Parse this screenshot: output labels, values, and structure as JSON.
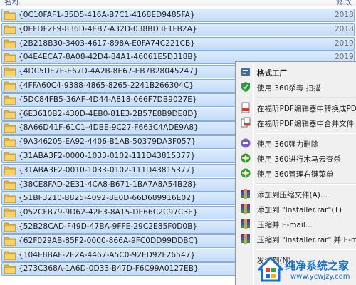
{
  "header": {
    "name_col": "名称",
    "date_col": "修改日"
  },
  "files": [
    {
      "name": "{0C10FAF1-35D5-416A-B7C1-4168ED9485FA}",
      "date": "2018."
    },
    {
      "name": "{0EFDF2F9-836D-4EB7-A32D-038BD3F1FB2A}",
      "date": "2018."
    },
    {
      "name": "{2B218B30-3403-4617-898A-E0FA74C221CB}",
      "date": "2019."
    },
    {
      "name": "{04E4ECA7-8A08-42D4-84A1-46061E5D318B}",
      "date": "2019."
    },
    {
      "name": "{4DC5DE7E-E67D-4A2B-8E67-EB7B28045247}",
      "date": ""
    },
    {
      "name": "{4FFA60C4-9388-4865-8265-2241B266304C}",
      "date": ""
    },
    {
      "name": "{5DC84FB5-36AF-4D44-A818-066F7DB9027E}",
      "date": ""
    },
    {
      "name": "{6E3610B2-430D-4EB0-81E3-2B57E8B9DE8D}",
      "date": ""
    },
    {
      "name": "{8A66D41F-61C1-4DBE-9C27-F663C4ADE9A8}",
      "date": ""
    },
    {
      "name": "{9A346205-EA92-4406-B1AB-50379DA3F057}",
      "date": ""
    },
    {
      "name": "{31ABA3F2-0000-1033-0102-111D43815377}",
      "date": ""
    },
    {
      "name": "{31ABA3F2-0010-1033-0102-111D43815377}",
      "date": ""
    },
    {
      "name": "{38CE8FAD-2E31-4CA8-B671-1BA7A8A54B28}",
      "date": ""
    },
    {
      "name": "{51BF3210-B825-4092-8E0D-66D689916E02}",
      "date": ""
    },
    {
      "name": "{052CFB79-9D62-42E3-8A15-DE66C2C97C3E}",
      "date": ""
    },
    {
      "name": "{52B28CAD-F49D-47BA-9FFE-29C2E85F0D0B}",
      "date": ""
    },
    {
      "name": "{62F029AB-85F2-0000-866A-9FC0DD99DDBC}",
      "date": ""
    },
    {
      "name": "{104E8BAF-2E2A-4467-A5C0-92ED92F26547}",
      "date": ""
    },
    {
      "name": "{273C368A-1A6D-0D33-B47D-F6C99A0127EB}",
      "date": ""
    }
  ],
  "context_menu": {
    "items": [
      {
        "label": "格式工厂",
        "icon": "format-factory-icon",
        "bold": true
      },
      {
        "label": "使用 360杀毒 扫描",
        "icon": "360-antivirus-icon"
      },
      {
        "separator": true
      },
      {
        "label": "在福昕PDF编辑器中转换成PDF",
        "icon": "pdf-convert-icon"
      },
      {
        "label": "在福昕PDF编辑器中合并文件",
        "icon": "pdf-merge-icon"
      },
      {
        "separator": true
      },
      {
        "label": "使用 360强力删除",
        "icon": "360-force-delete-icon"
      },
      {
        "label": "使用 360进行木马云查杀",
        "icon": "360-trojan-scan-icon"
      },
      {
        "label": "使用 360管理右键菜单",
        "icon": "360-context-menu-icon"
      },
      {
        "separator": true
      },
      {
        "label": "添加到压缩文件(A)...",
        "icon": "winrar-add-icon"
      },
      {
        "label": "添加到 \"Installer.rar\"(T)",
        "icon": "winrar-add-named-icon"
      },
      {
        "label": "压缩并 E-mail...",
        "icon": "winrar-email-icon"
      },
      {
        "label": "压缩到 \"Installer.rar\" 并 E-mail",
        "icon": "winrar-compress-email-icon"
      },
      {
        "separator": true
      },
      {
        "label": "发送到(N)",
        "icon": ""
      }
    ]
  },
  "watermark": {
    "title": "纯净系统之家",
    "url": "www.ycwjzy.com"
  },
  "colors": {
    "selection": "#cce0f8",
    "folder": "#f2c654",
    "menu_bg": "#f0f0f0",
    "watermark": "#1a6fc8"
  }
}
